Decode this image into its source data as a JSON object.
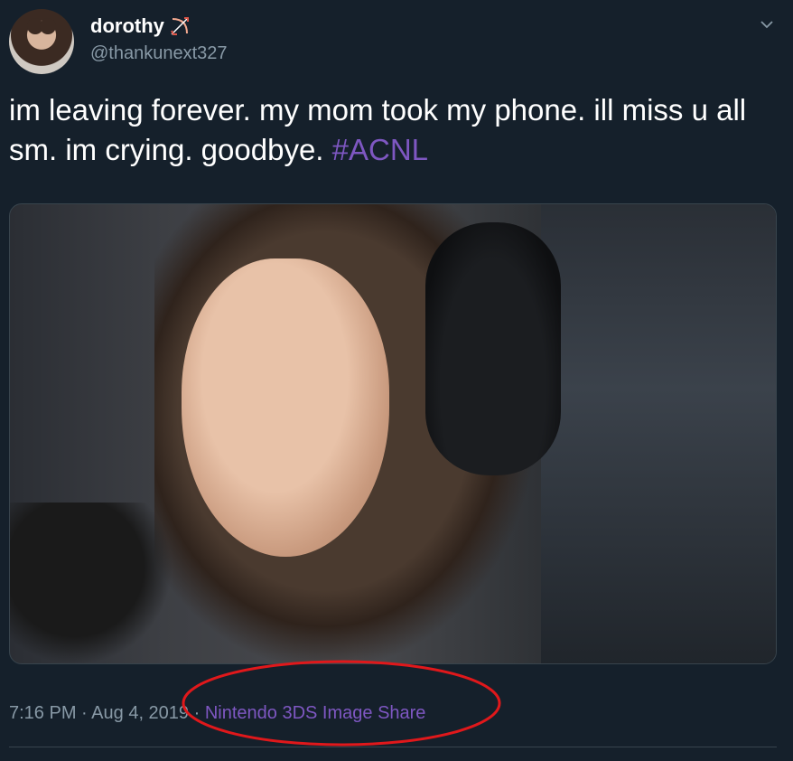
{
  "user": {
    "display_name": "dorothy",
    "handle": "@thankunext327",
    "emoji": "bow-and-arrow"
  },
  "tweet": {
    "text": "im leaving forever. my mom took my phone. ill miss u all sm. im crying. goodbye.",
    "hashtag": "#ACNL",
    "image_alt": "photo of crying woman wearing headphones"
  },
  "meta": {
    "time": "7:16 PM",
    "date": "Aug 4, 2019",
    "separator": "·",
    "source": "Nintendo 3DS Image Share"
  },
  "colors": {
    "background": "#15202b",
    "text": "#ffffff",
    "secondary": "#8899a6",
    "accent": "#7e57c2",
    "annotation": "#e0181b"
  }
}
